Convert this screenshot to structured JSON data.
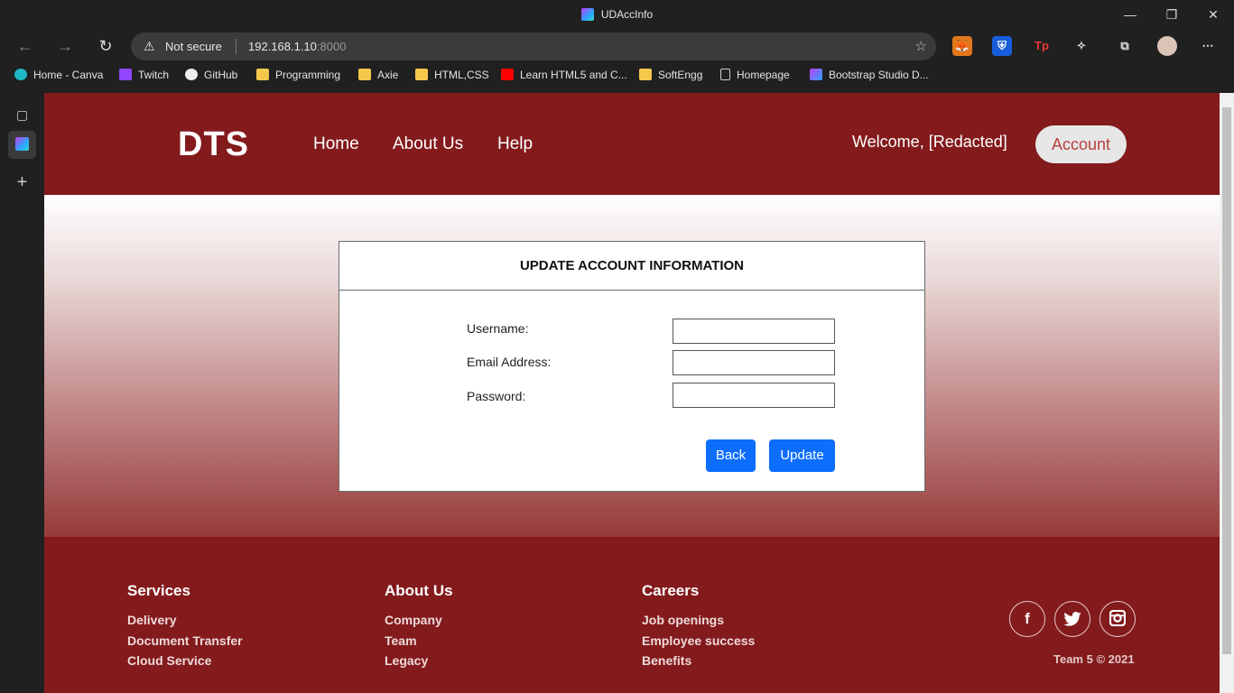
{
  "browser": {
    "tab_title": "UDAccInfo",
    "security": "Not secure",
    "url_host": "192.168.1.10",
    "url_port": ":8000"
  },
  "bookmarks": [
    {
      "label": "Home - Canva"
    },
    {
      "label": "Twitch"
    },
    {
      "label": "GitHub"
    },
    {
      "label": "Programming"
    },
    {
      "label": "Axie"
    },
    {
      "label": "HTML,CSS"
    },
    {
      "label": "Learn HTML5 and C..."
    },
    {
      "label": "SoftEngg"
    },
    {
      "label": "Homepage"
    },
    {
      "label": "Bootstrap Studio D..."
    }
  ],
  "header": {
    "logo": "DTS",
    "nav": [
      "Home",
      "About Us",
      "Help"
    ],
    "welcome": "Welcome, [Redacted]",
    "account_label": "Account"
  },
  "form": {
    "title": "UPDATE ACCOUNT INFORMATION",
    "username_label": "Username:",
    "email_label": "Email Address:",
    "password_label": "Password:",
    "username_value": "",
    "email_value": "",
    "password_value": "",
    "back_label": "Back",
    "update_label": "Update"
  },
  "footer": {
    "columns": [
      {
        "title": "Services",
        "links": [
          "Delivery",
          "Document Transfer",
          "Cloud Service"
        ]
      },
      {
        "title": "About Us",
        "links": [
          "Company",
          "Team",
          "Legacy"
        ]
      },
      {
        "title": "Careers",
        "links": [
          "Job openings",
          "Employee success",
          "Benefits"
        ]
      }
    ],
    "social": [
      "facebook-icon",
      "twitter-icon",
      "instagram-icon"
    ],
    "copyright": "Team 5 © 2021"
  },
  "colors": {
    "brand": "#831a1c",
    "primary_button": "#0d6efd",
    "account_text": "#b9403f"
  }
}
